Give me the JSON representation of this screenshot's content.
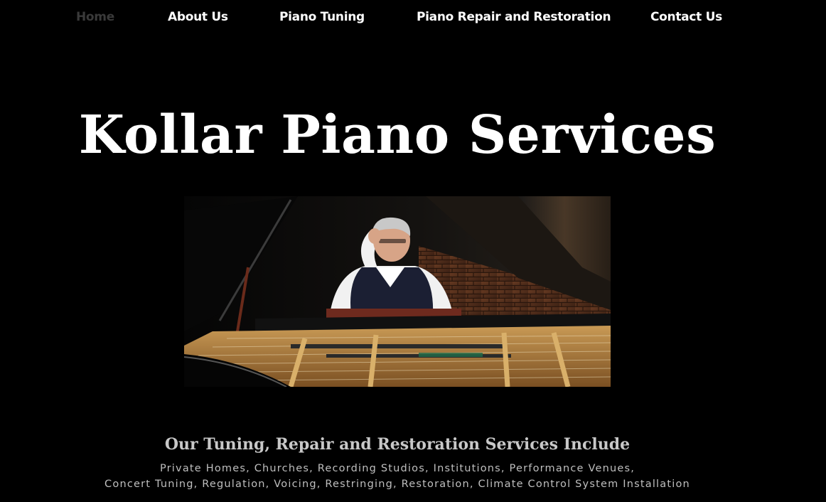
{
  "nav": {
    "items": [
      {
        "label": "Home",
        "active": true
      },
      {
        "label": "About Us",
        "active": false
      },
      {
        "label": "Piano Tuning",
        "active": false
      },
      {
        "label": "Piano Repair and Restoration",
        "active": false
      },
      {
        "label": "Contact Us",
        "active": false
      }
    ]
  },
  "header": {
    "title": "Kollar Piano Services"
  },
  "hero": {
    "image_subject": "pianist-seated-at-open-grand-piano"
  },
  "services": {
    "heading": "Our Tuning, Repair and Restoration Services Include",
    "line1": "Private Homes, Churches, Recording Studios, Institutions, Performance Venues,",
    "line2": "Concert Tuning, Regulation, Voicing, Restringing, Restoration, Climate Control System Installation"
  },
  "colors": {
    "background": "#000000",
    "nav_text": "#ffffff",
    "nav_active_text": "#3a3a3a",
    "title_text": "#ffffff",
    "services_heading_text": "#c8c8c8",
    "services_text": "#bfbfbf"
  }
}
